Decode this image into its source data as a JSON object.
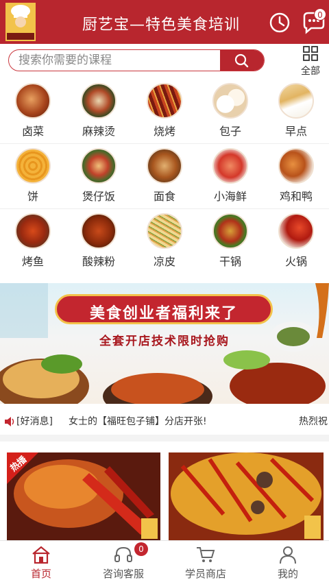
{
  "header": {
    "title": "厨艺宝—特色美食培训",
    "message_count": "0",
    "colors": {
      "brand": "#b8262e",
      "badge_text": "#b8262e"
    }
  },
  "search": {
    "placeholder": "搜索你需要的课程",
    "all_label": "全部"
  },
  "categories": [
    {
      "label": "卤菜",
      "icon": "braised-meat-icon"
    },
    {
      "label": "麻辣烫",
      "icon": "spicy-hotpot-icon"
    },
    {
      "label": "烧烤",
      "icon": "bbq-icon"
    },
    {
      "label": "包子",
      "icon": "steamed-bun-icon"
    },
    {
      "label": "早点",
      "icon": "breakfast-icon"
    },
    {
      "label": "饼",
      "icon": "pancake-icon"
    },
    {
      "label": "煲仔饭",
      "icon": "claypot-rice-icon"
    },
    {
      "label": "面食",
      "icon": "noodles-icon"
    },
    {
      "label": "小海鲜",
      "icon": "seafood-icon"
    },
    {
      "label": "鸡和鸭",
      "icon": "chicken-duck-icon"
    },
    {
      "label": "烤鱼",
      "icon": "grilled-fish-icon"
    },
    {
      "label": "酸辣粉",
      "icon": "sour-spicy-noodle-icon"
    },
    {
      "label": "凉皮",
      "icon": "cold-noodle-icon"
    },
    {
      "label": "干锅",
      "icon": "dry-pot-icon"
    },
    {
      "label": "火锅",
      "icon": "hotpot-icon"
    }
  ],
  "banner": {
    "title": "美食创业者福利来了",
    "subtitle": "全套开店技术限时抢购"
  },
  "news": {
    "tag": "[好消息]",
    "text": "女士的【福旺包子铺】分店开张!",
    "text2": "热烈祝"
  },
  "courses": [
    {
      "tag": "热播"
    },
    {
      "tag": ""
    }
  ],
  "tabbar": {
    "items": [
      {
        "label": "首页",
        "icon": "home-icon",
        "active": true
      },
      {
        "label": "咨询客服",
        "icon": "headset-icon",
        "badge": "0"
      },
      {
        "label": "学员商店",
        "icon": "cart-icon"
      },
      {
        "label": "我的",
        "icon": "user-icon"
      }
    ]
  }
}
